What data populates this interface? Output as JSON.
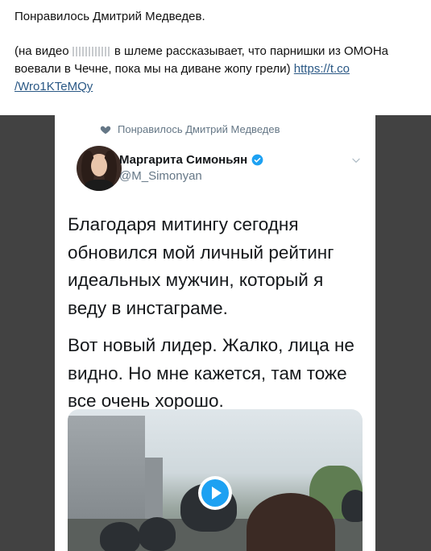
{
  "post": {
    "line1": "Понравилось Дмитрий Медведев.",
    "line2_prefix": "(на видео",
    "line2_rest": "в шлеме рассказывает, что парнишки из ОМОНа",
    "line3": "воевали в Чечне, пока мы на диване жопу грели)",
    "link_text_1": "https://t.co",
    "link_text_2": "/Wro1KTeMQy"
  },
  "tweet": {
    "liked_by": "Понравилось Дмитрий Медведев",
    "author_name": "Маргарита Симоньян",
    "author_handle": "@M_Simonyan",
    "paragraphs": [
      "Благодаря митингу сегодня обновился мой личный рейтинг идеальных мужчин, который я веду в инстаграме.",
      "Вот новый лидер. Жалко, лица не видно. Но мне кажется, там тоже все очень хорошо."
    ]
  },
  "colors": {
    "link": "#2a5885",
    "verified": "#1da1f2",
    "muted": "#657786",
    "frame": "#3a3a3a"
  },
  "icons": {
    "liked": "heart-icon",
    "verified": "verified-badge-icon",
    "menu": "chevron-down-icon",
    "play": "play-icon"
  }
}
